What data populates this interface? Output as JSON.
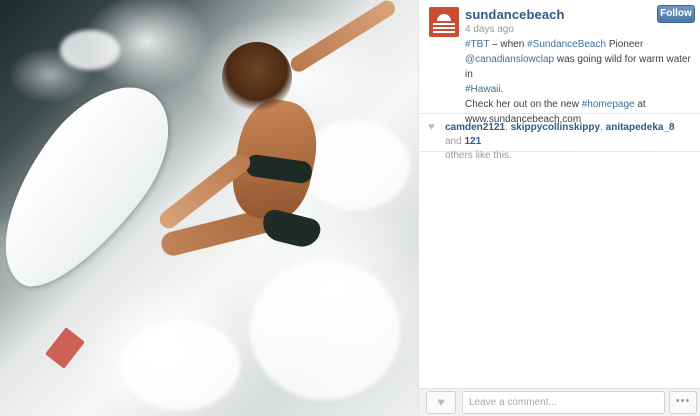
{
  "post": {
    "username": "sundancebeach",
    "time": "4 days ago",
    "follow_label": "Follow",
    "caption": {
      "hashtag_tbt": "#TBT",
      "dash_when": " – when ",
      "hashtag_sundance": "#SundanceBeach",
      "pioneer": " Pioneer",
      "mention": "@canadianslowclap",
      "going_wild": " was going wild for warm water in ",
      "hashtag_hawaii": "#Hawaii",
      "period": ".",
      "check_out": "Check her out on the new ",
      "hashtag_homepage": "#homepage",
      "at": " at",
      "url": "www.sundancebeach.com"
    }
  },
  "likes": {
    "users": [
      "camden2121",
      "skippycollinskippy",
      "anitapedeka_8"
    ],
    "sep1": ", ",
    "sep2": ", ",
    "and": " and ",
    "count": "121",
    "suffix": " others like this."
  },
  "footer": {
    "comment_placeholder": "Leave a comment...",
    "more_label": "•••"
  },
  "icons": {
    "heart": "♥"
  },
  "colors": {
    "username": "#2f5b85",
    "link": "#3f729b",
    "follow_button": "#5a83ae",
    "brand": "#c94e34"
  }
}
